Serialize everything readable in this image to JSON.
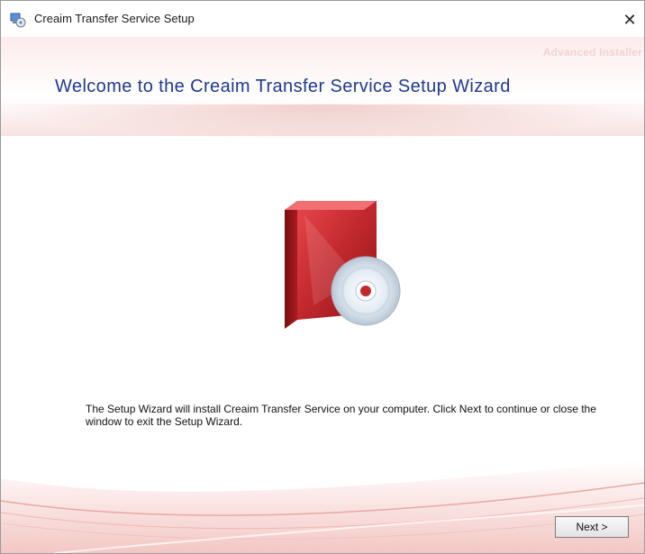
{
  "window": {
    "title": "Creaim Transfer Service Setup",
    "close_glyph": "✕",
    "app_icon": "setup-icon"
  },
  "header": {
    "brand": "Advanced Installer",
    "heading": "Welcome to the Creaim Transfer Service Setup Wizard"
  },
  "body": {
    "description": "The Setup Wizard will install Creaim Transfer Service on your computer. Click Next to continue or close the window to exit the Setup Wizard.",
    "art_icon": "software-box-cd-icon"
  },
  "footer": {
    "next_label": "Next >"
  },
  "colors": {
    "heading": "#1f3a8c",
    "accent": "#c0282d",
    "wave": "#e7a8a4"
  }
}
